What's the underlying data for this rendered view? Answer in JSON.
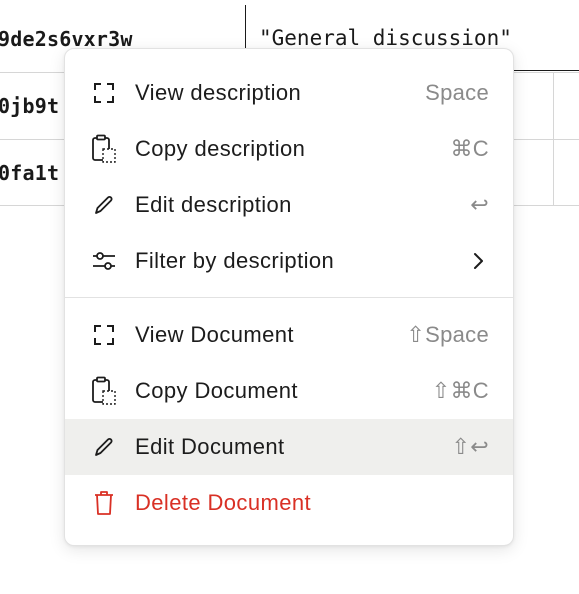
{
  "table": {
    "rows": [
      {
        "id": "9de2s6vxr3w"
      },
      {
        "id": "0jb9t"
      },
      {
        "id": "0fa1t"
      }
    ],
    "selected_cell_value": "\"General discussion\""
  },
  "menu": {
    "group1": [
      {
        "label": "View description",
        "shortcut": "Space",
        "icon": "expand-frame-icon"
      },
      {
        "label": "Copy description",
        "shortcut": "⌘C",
        "icon": "clipboard-copy-icon"
      },
      {
        "label": "Edit description",
        "shortcut": "↩",
        "icon": "pencil-icon"
      },
      {
        "label": "Filter by description",
        "shortcut": "",
        "icon": "filter-sliders-icon",
        "submenu": true
      }
    ],
    "group2": [
      {
        "label": "View Document",
        "shortcut": "⇧Space",
        "icon": "expand-frame-icon"
      },
      {
        "label": "Copy Document",
        "shortcut": "⇧⌘C",
        "icon": "clipboard-copy-icon"
      },
      {
        "label": "Edit Document",
        "shortcut": "⇧↩",
        "icon": "pencil-icon",
        "highlighted": true
      },
      {
        "label": "Delete Document",
        "shortcut": "",
        "icon": "trash-icon",
        "danger": true
      }
    ]
  },
  "colors": {
    "danger": "#d93025",
    "highlight": "#efefed",
    "shortcut": "#8a8a8a"
  }
}
